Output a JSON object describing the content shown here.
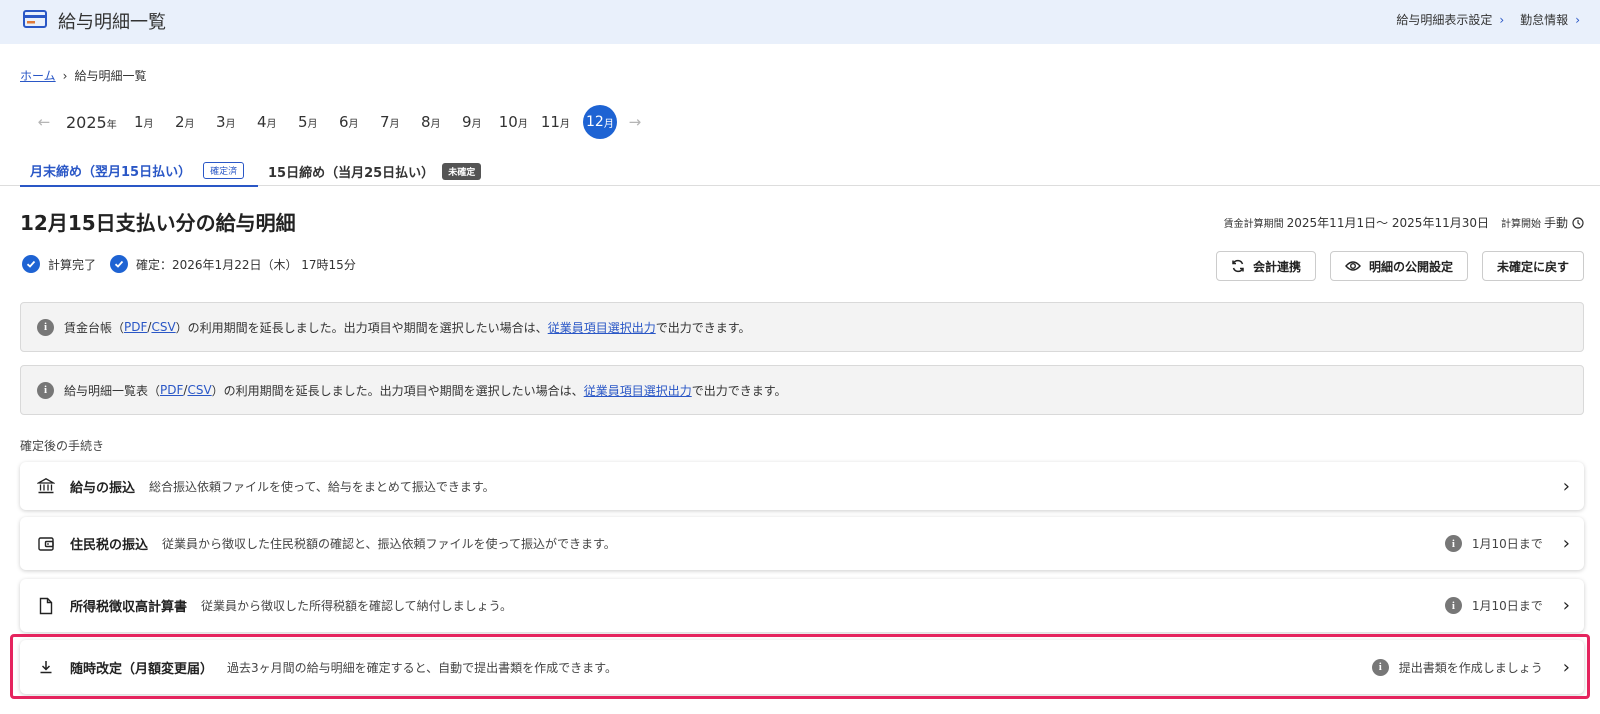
{
  "header": {
    "title": "給与明細一覧",
    "links": [
      "給与明細表示設定",
      "勤怠情報"
    ]
  },
  "breadcrumb": {
    "home": "ホーム",
    "current": "給与明細一覧"
  },
  "calendar": {
    "year": "2025",
    "year_unit": "年",
    "month_unit": "月",
    "months": [
      "1",
      "2",
      "3",
      "4",
      "5",
      "6",
      "7",
      "8",
      "9",
      "10",
      "11"
    ],
    "active_month": "12"
  },
  "tabs": [
    {
      "label": "月末締め（翌月15日払い）",
      "badge": "確定済"
    },
    {
      "label": "15日締め（当月25日払い）",
      "badge": "未確定"
    }
  ],
  "heading": "12月15日支払い分の給与明細",
  "period": {
    "label": "賃金計算期間",
    "value": "2025年11月1日～ 2025年11月30日",
    "start_label": "計算開始",
    "start_value": "手動"
  },
  "status": {
    "calc": "計算完了",
    "confirmed": "確定：2026年1月22日（木） 17時15分"
  },
  "buttons": {
    "accounting": "会計連携",
    "publish": "明細の公開設定",
    "unconfirm": "未確定に戻す"
  },
  "notices": [
    {
      "before": "賃金台帳（",
      "pdf": "PDF",
      "slash": "/",
      "csv": "CSV",
      "after": "）の利用期間を延長しました。出力項目や期間を選択したい場合は、",
      "link": "従業員項目選択出力",
      "tail": "で出力できます。"
    },
    {
      "before": "給与明細一覧表（",
      "pdf": "PDF",
      "slash": "/",
      "csv": "CSV",
      "after": "）の利用期間を延長しました。出力項目や期間を選択したい場合は、",
      "link": "従業員項目選択出力",
      "tail": "で出力できます。"
    }
  ],
  "section_label": "確定後の手続き",
  "procedures": [
    {
      "title": "給与の振込",
      "desc": "総合振込依頼ファイルを使って、給与をまとめて振込できます。",
      "note": ""
    },
    {
      "title": "住民税の振込",
      "desc": "従業員から徴収した住民税額の確認と、振込依頼ファイルを使って振込ができます。",
      "note": "1月10日まで"
    },
    {
      "title": "所得税徴収高計算書",
      "desc": "従業員から徴収した所得税額を確認して納付しましょう。",
      "note": "1月10日まで"
    },
    {
      "title": "随時改定（月額変更届）",
      "desc": "過去3ヶ月間の給与明細を確定すると、自動で提出書類を作成できます。",
      "note": "提出書類を作成しましょう"
    }
  ],
  "colors": {
    "accent": "#1e63d3",
    "highlight": "#e5245e",
    "header_bg": "#e9f0fb"
  }
}
